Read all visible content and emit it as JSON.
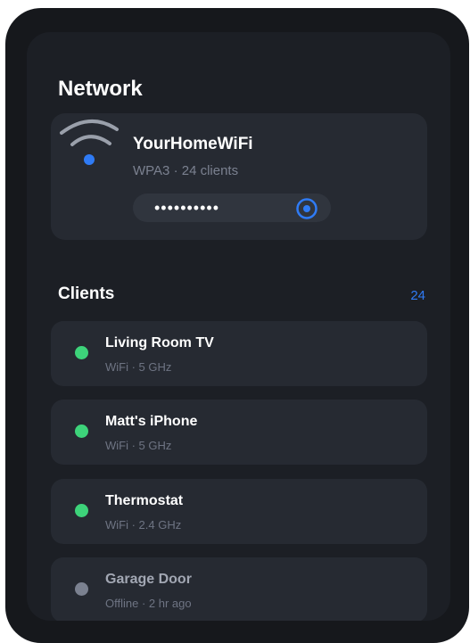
{
  "header": {
    "title": "Network"
  },
  "wifi": {
    "ssid": "YourHomeWiFi",
    "meta": "WPA3 · 24 clients",
    "password_masked": "••••••••••",
    "icon": "wifi-icon",
    "reveal_icon": "eye-icon"
  },
  "clients": {
    "heading": "Clients",
    "count": "24",
    "items": [
      {
        "name": "Living Room TV",
        "sub": "WiFi · 5 GHz",
        "status": "online"
      },
      {
        "name": "Matt's iPhone",
        "sub": "WiFi · 5 GHz",
        "status": "online"
      },
      {
        "name": "Thermostat",
        "sub": "WiFi · 2.4 GHz",
        "status": "online"
      },
      {
        "name": "Garage Door",
        "sub": "Offline · 2 hr ago",
        "status": "offline"
      }
    ]
  },
  "colors": {
    "accent": "#2f7bf5",
    "online": "#3dd37a",
    "offline": "#7b8190"
  }
}
